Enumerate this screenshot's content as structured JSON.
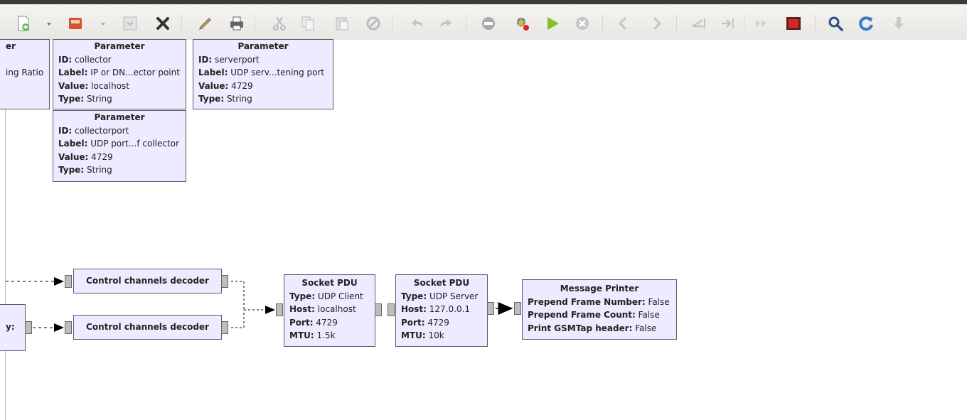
{
  "toolbar": {
    "icons": [
      "new-file-icon",
      "open-file-icon",
      "save-icon",
      "close-icon",
      "edit-icon",
      "print-icon",
      "cut-icon",
      "copy-icon",
      "paste-icon",
      "disable-icon",
      "undo-icon",
      "redo-icon",
      "stop-block-icon",
      "generate-icon",
      "run-icon",
      "kill-icon",
      "prev-icon",
      "next-icon",
      "rotate-left-icon",
      "rotate-right-icon",
      "forward-icon",
      "record-icon",
      "search-icon",
      "refresh-icon",
      "download-icon"
    ]
  },
  "blocks": {
    "partial_param": {
      "title": "er",
      "row1": "ing Ratio"
    },
    "param_collector": {
      "title": "Parameter",
      "id_k": "ID:",
      "id_v": " collector",
      "label_k": "Label:",
      "label_v": " IP or DN...ector point",
      "value_k": "Value:",
      "value_v": " localhost",
      "type_k": "Type:",
      "type_v": " String"
    },
    "param_serverport": {
      "title": "Parameter",
      "id_k": "ID:",
      "id_v": " serverport",
      "label_k": "Label:",
      "label_v": " UDP serv...tening port",
      "value_k": "Value:",
      "value_v": " 4729",
      "type_k": "Type:",
      "type_v": " String"
    },
    "param_collectorport": {
      "title": "Parameter",
      "id_k": "ID:",
      "id_v": " collectorport",
      "label_k": "Label:",
      "label_v": " UDP port...f collector",
      "value_k": "Value:",
      "value_v": " 4729",
      "type_k": "Type:",
      "type_v": " String"
    },
    "decoder1": {
      "title": "Control channels decoder"
    },
    "decoder2": {
      "title": "Control channels decoder"
    },
    "partial_left": {
      "text": "y:"
    },
    "socket_client": {
      "title": "Socket PDU",
      "type_k": "Type:",
      "type_v": " UDP Client",
      "host_k": "Host:",
      "host_v": " localhost",
      "port_k": "Port:",
      "port_v": " 4729",
      "mtu_k": "MTU:",
      "mtu_v": " 1.5k"
    },
    "socket_server": {
      "title": "Socket PDU",
      "type_k": "Type:",
      "type_v": " UDP Server",
      "host_k": "Host:",
      "host_v": " 127.0.0.1",
      "port_k": "Port:",
      "port_v": " 4729",
      "mtu_k": "MTU:",
      "mtu_v": " 10k"
    },
    "printer": {
      "title": "Message Printer",
      "r1_k": "Prepend Frame Number:",
      "r1_v": " False",
      "r2_k": "Prepend Frame Count:",
      "r2_v": " False",
      "r3_k": "Print GSMTap header:",
      "r3_v": " False"
    }
  }
}
